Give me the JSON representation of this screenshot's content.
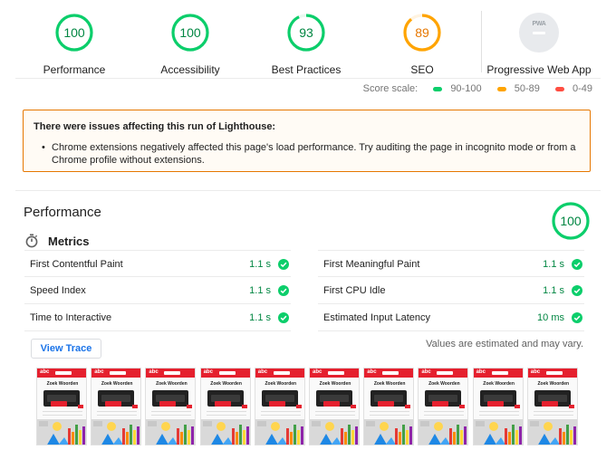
{
  "colors": {
    "pass": "#0cce6b",
    "pass_text": "#018642",
    "average": "#ffa400",
    "average_text": "#e67700",
    "fail": "#ff4e42",
    "fail_text": "#cc0000",
    "warning_border": "#e67700",
    "link": "#1a73e8"
  },
  "gauges": [
    {
      "score": "100",
      "value": 100,
      "label": "Performance",
      "status": "pass"
    },
    {
      "score": "100",
      "value": 100,
      "label": "Accessibility",
      "status": "pass"
    },
    {
      "score": "93",
      "value": 93,
      "label": "Best Practices",
      "status": "pass"
    },
    {
      "score": "89",
      "value": 89,
      "label": "SEO",
      "status": "average"
    }
  ],
  "pwa": {
    "badge_text": "PWA",
    "label": "Progressive Web App"
  },
  "score_scale": {
    "label": "Score scale:",
    "ranges": [
      {
        "text": "90-100",
        "color": "#0cce6b"
      },
      {
        "text": "50-89",
        "color": "#ffa400"
      },
      {
        "text": "0-49",
        "color": "#ff4e42"
      }
    ]
  },
  "warning": {
    "title": "There were issues affecting this run of Lighthouse:",
    "items": [
      "Chrome extensions negatively affected this page's load performance. Try auditing the page in incognito mode or from a Chrome profile without extensions."
    ]
  },
  "performance": {
    "title": "Performance",
    "score": "100",
    "score_value": 100,
    "metrics_label": "Metrics",
    "metrics_icon": "stopwatch-icon",
    "metrics": [
      {
        "name": "First Contentful Paint",
        "value": "1.1 s"
      },
      {
        "name": "First Meaningful Paint",
        "value": "1.1 s"
      },
      {
        "name": "Speed Index",
        "value": "1.1 s"
      },
      {
        "name": "First CPU Idle",
        "value": "1.1 s"
      },
      {
        "name": "Time to Interactive",
        "value": "1.1 s"
      },
      {
        "name": "Estimated Input Latency",
        "value": "10 ms"
      }
    ],
    "view_trace_label": "View Trace",
    "estimate_note": "Values are estimated and may vary."
  },
  "filmstrip": {
    "frame_count": 10,
    "frame": {
      "logo": "abc",
      "title": "Zoek Woorden"
    }
  }
}
